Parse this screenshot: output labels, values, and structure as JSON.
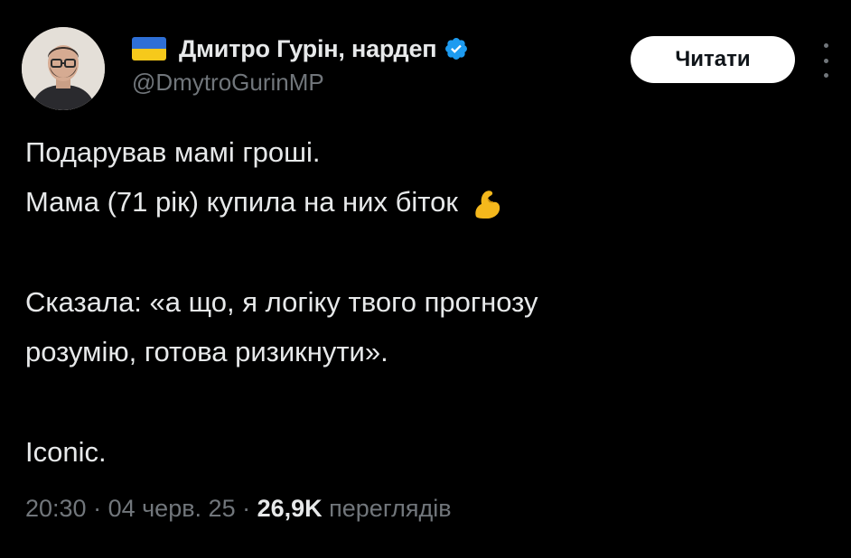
{
  "author": {
    "flag_icon": "ukraine-flag-icon",
    "display_name": "Дмитро Гурін, нардеп",
    "verified_icon": "verified-badge-icon",
    "handle": "@DmytroGurinMP"
  },
  "actions": {
    "follow_label": "Читати",
    "more_icon": "more-vertical-icon"
  },
  "tweet": {
    "line1": "Подарував мамі гроші.",
    "line2": "Мама (71 рік) купила на них біток",
    "line2_emoji_icon": "flexed-biceps-icon",
    "line3": "Сказала: «а що, я логіку твого прогнозу",
    "line4": "розумію, готова ризикнути».",
    "line5": "Iconic."
  },
  "meta": {
    "time": "20:30",
    "separator1": " · ",
    "date": "04 черв. 25",
    "separator2": " · ",
    "views_count": "26,9K",
    "views_label": " переглядів"
  },
  "colors": {
    "background": "#000000",
    "primary_text": "#e7e9ea",
    "secondary_text": "#71767b",
    "verified_blue": "#1d9bf0",
    "button_bg": "#ffffff",
    "flag_blue": "#2e6fd6",
    "flag_yellow": "#f6c91b"
  }
}
